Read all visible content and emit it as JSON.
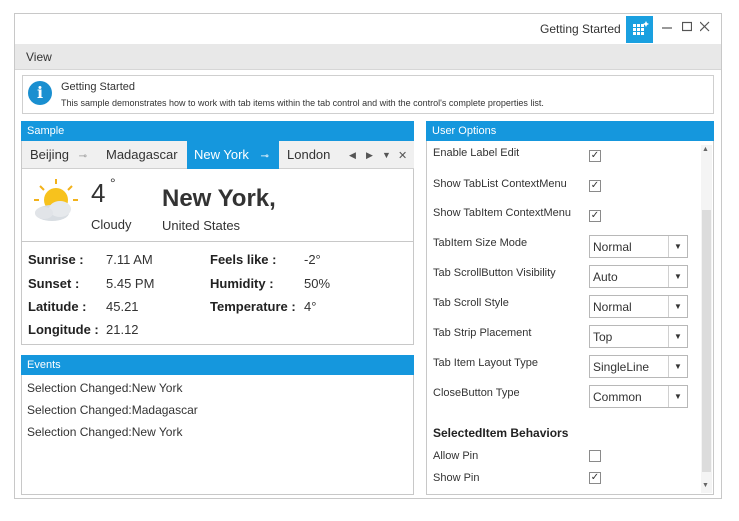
{
  "window": {
    "title": "Getting Started"
  },
  "menu": {
    "view": "View"
  },
  "info": {
    "icon_glyph": "i",
    "title": "Getting Started",
    "description": "This sample demonstrates how to work with tab items within the tab control and with the control's complete properties list."
  },
  "sample": {
    "header": "Sample",
    "tabs": [
      {
        "label": "Beijing"
      },
      {
        "label": "Madagascar"
      },
      {
        "label": "New York"
      },
      {
        "label": "London"
      }
    ],
    "weather": {
      "temperature": "4",
      "degree_mark": "°",
      "condition": "Cloudy",
      "city": "New York,",
      "country": "United States"
    },
    "details": [
      {
        "label": "Sunrise :",
        "value": "7.11 AM"
      },
      {
        "label": "Sunset :",
        "value": "5.45 PM"
      },
      {
        "label": "Latitude :",
        "value": "45.21"
      },
      {
        "label": "Longitude :",
        "value": "21.12"
      },
      {
        "label": "Feels like :",
        "value": "-2°"
      },
      {
        "label": "Humidity :",
        "value": "50%"
      },
      {
        "label": "Temperature :",
        "value": "4°"
      }
    ]
  },
  "events": {
    "header": "Events",
    "items": [
      "Selection Changed:New York",
      "Selection Changed:Madagascar",
      "Selection Changed:New York"
    ]
  },
  "options": {
    "header": "User Options",
    "checks": [
      {
        "label": "Enable Label Edit",
        "checked": true
      },
      {
        "label": "Show TabList ContextMenu",
        "checked": true
      },
      {
        "label": "Show TabItem ContextMenu",
        "checked": true
      }
    ],
    "dropdowns": [
      {
        "label": "TabItem Size Mode",
        "value": "Normal"
      },
      {
        "label": "Tab ScrollButton Visibility",
        "value": "Auto"
      },
      {
        "label": "Tab Scroll Style",
        "value": "Normal"
      },
      {
        "label": "Tab Strip Placement",
        "value": "Top"
      },
      {
        "label": "Tab Item Layout Type",
        "value": "SingleLine"
      },
      {
        "label": "CloseButton Type",
        "value": "Common"
      }
    ],
    "section_title": "SelectedItem Behaviors",
    "behaviors": [
      {
        "label": "Allow Pin",
        "checked": false
      },
      {
        "label": "Show Pin",
        "checked": true
      }
    ]
  },
  "glyphs": {
    "check": "✓",
    "dropdown": "▼",
    "pin": "⊸",
    "close": "✕",
    "left": "◀",
    "right": "▶",
    "list": "▼"
  },
  "colors": {
    "accent": "#1597dd"
  }
}
